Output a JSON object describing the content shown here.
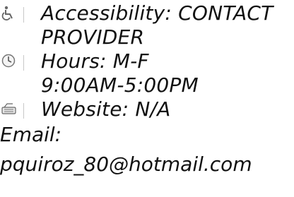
{
  "accessibility": {
    "icon": "wheelchair-icon",
    "line1": "Accessibility: CONTACT",
    "line2": "PROVIDER"
  },
  "hours": {
    "icon": "clock-icon",
    "line1": "Hours: M-F",
    "line2": "9:00AM-5:00PM"
  },
  "website": {
    "icon": "keyboard-icon",
    "label": "Website: N/A"
  },
  "email": {
    "label": "Email:",
    "value": "pquiroz_80@hotmail.com"
  }
}
